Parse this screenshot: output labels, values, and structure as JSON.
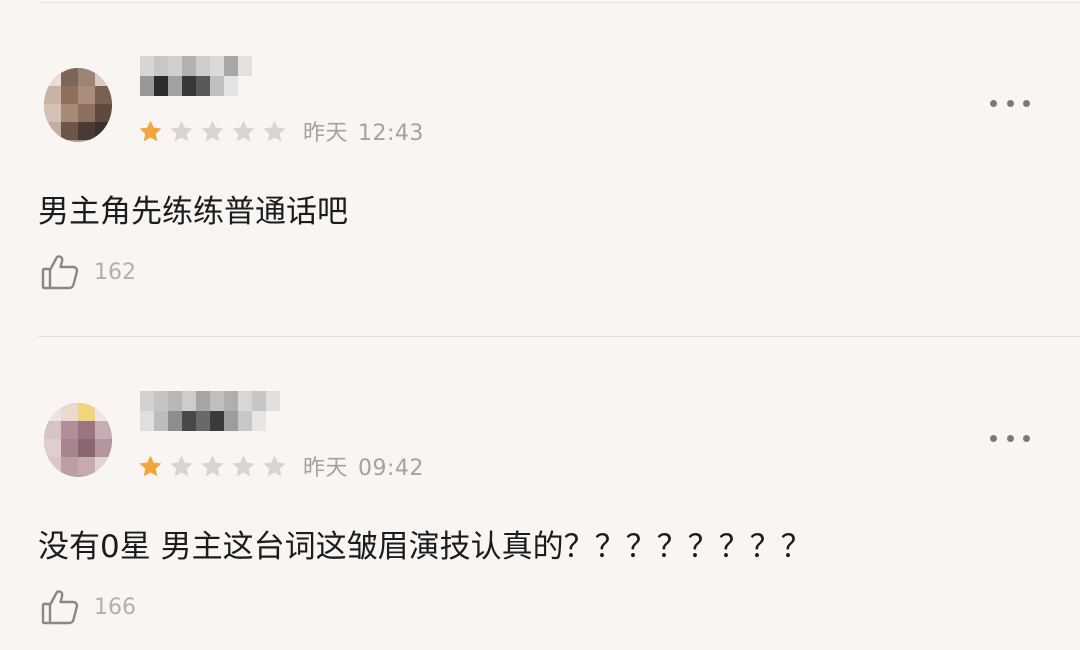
{
  "icons": {
    "star_filled_color": "#f3a43b",
    "star_empty_color": "#d8d4d0",
    "like_icon": "thumbs-up-icon",
    "more_icon": "more-dots-icon"
  },
  "comments": [
    {
      "rating": 1,
      "rating_max": 5,
      "date": "昨天",
      "time": "12:43",
      "content": "男主角先练练普通话吧",
      "likes": "162"
    },
    {
      "rating": 1,
      "rating_max": 5,
      "date": "昨天",
      "time": "09:42",
      "content": "没有0星 男主这台词这皱眉演技认真的？？？？？？？？",
      "likes": "166"
    }
  ]
}
